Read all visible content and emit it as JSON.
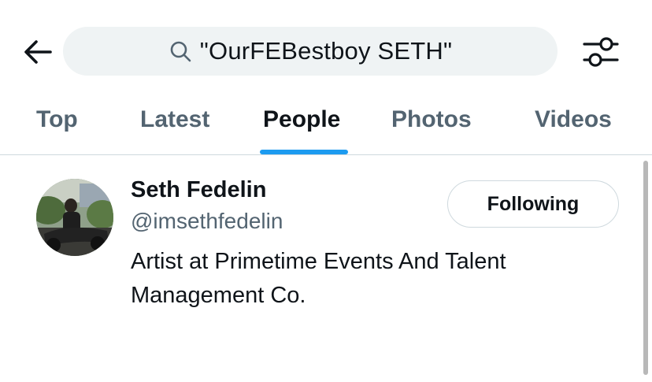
{
  "search": {
    "query": "\"OurFEBestboy SETH\"",
    "icon": "search-icon"
  },
  "header": {
    "back_icon": "arrow-left-icon",
    "filter_icon": "sliders-icon"
  },
  "tabs": [
    {
      "label": "Top",
      "active": false
    },
    {
      "label": "Latest",
      "active": false
    },
    {
      "label": "People",
      "active": true
    },
    {
      "label": "Photos",
      "active": false
    },
    {
      "label": "Videos",
      "active": false
    }
  ],
  "results": [
    {
      "name": "Seth Fedelin",
      "handle": "@imsethfedelin",
      "bio": "Artist at Primetime Events And Talent Management Co.",
      "follow_label": "Following"
    }
  ],
  "colors": {
    "accent": "#1d9bf0",
    "text": "#0f1419",
    "secondary": "#536471",
    "search_bg": "#eff3f4",
    "border": "#cfd9de"
  }
}
